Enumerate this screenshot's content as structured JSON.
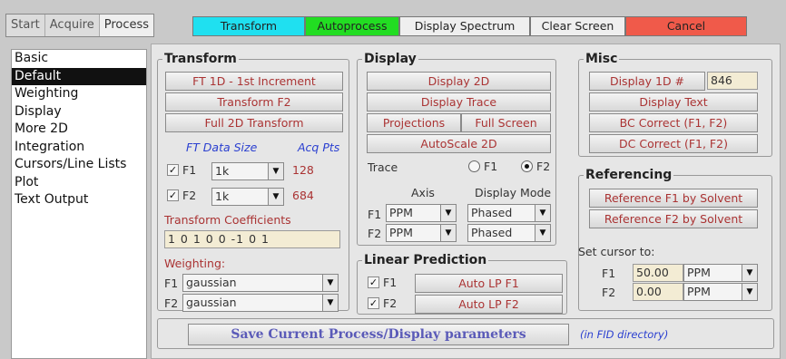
{
  "tabs": [
    "Start",
    "Acquire",
    "Process"
  ],
  "toolbar": {
    "transform": "Transform",
    "autoprocess": "Autoprocess",
    "display_spectrum": "Display Spectrum",
    "clear_screen": "Clear Screen",
    "cancel": "Cancel",
    "colors": {
      "transform": "#1fe0f0",
      "autoprocess": "#22dd22",
      "cancel": "#f05a4a"
    }
  },
  "sidebar": {
    "items": [
      "Basic",
      "Default",
      "Weighting",
      "Display",
      "More 2D",
      "Integration",
      "Cursors/Line Lists",
      "Plot",
      "Text Output"
    ],
    "selected": "Default"
  },
  "transform": {
    "title": "Transform",
    "ft1d": "FT 1D - 1st Increment",
    "transform_f2": "Transform F2",
    "full2d": "Full 2D Transform",
    "ft_data_size": "FT Data Size",
    "acq_pts": "Acq Pts",
    "f1_label": "F1",
    "f1_size": "1k",
    "f1_pts": "128",
    "f2_label": "F2",
    "f2_size": "1k",
    "f2_pts": "684",
    "coeff_label": "Transform Coefficients",
    "coeff_value": "1 0 1 0 0 -1 0 1",
    "weighting_label": "Weighting:",
    "w_f1_label": "F1",
    "w_f1": "gaussian",
    "w_f2_label": "F2",
    "w_f2": "gaussian"
  },
  "display": {
    "title": "Display",
    "display2d": "Display 2D",
    "display_trace": "Display Trace",
    "projections": "Projections",
    "full_screen": "Full Screen",
    "autoscale": "AutoScale 2D",
    "trace_label": "Trace",
    "trace_f1": "F1",
    "trace_f2": "F2",
    "axis_label": "Axis",
    "mode_label": "Display Mode",
    "f1_label": "F1",
    "f1_axis": "PPM",
    "f1_mode": "Phased",
    "f2_label": "F2",
    "f2_axis": "PPM",
    "f2_mode": "Phased"
  },
  "linear_prediction": {
    "title": "Linear Prediction",
    "f1_label": "F1",
    "f1_button": "Auto LP F1",
    "f2_label": "F2",
    "f2_button": "Auto LP F2"
  },
  "misc": {
    "title": "Misc",
    "display1d": "Display 1D #",
    "display1d_value": "846",
    "display_text": "Display Text",
    "bc_correct": "BC Correct (F1, F2)",
    "dc_correct": "DC Correct (F1, F2)"
  },
  "referencing": {
    "title": "Referencing",
    "ref_f1": "Reference F1 by Solvent",
    "ref_f2": "Reference F2 by Solvent",
    "cursor_label": "Set cursor to:",
    "f1_label": "F1",
    "f1_value": "50.00",
    "f1_unit": "PPM",
    "f2_label": "F2",
    "f2_value": "0.00",
    "f2_unit": "PPM"
  },
  "footer": {
    "save": "Save Current Process/Display parameters",
    "note": "(in FID directory)"
  },
  "icons": {
    "dropdown": "chevron-down-icon",
    "check": "checkmark-icon"
  }
}
